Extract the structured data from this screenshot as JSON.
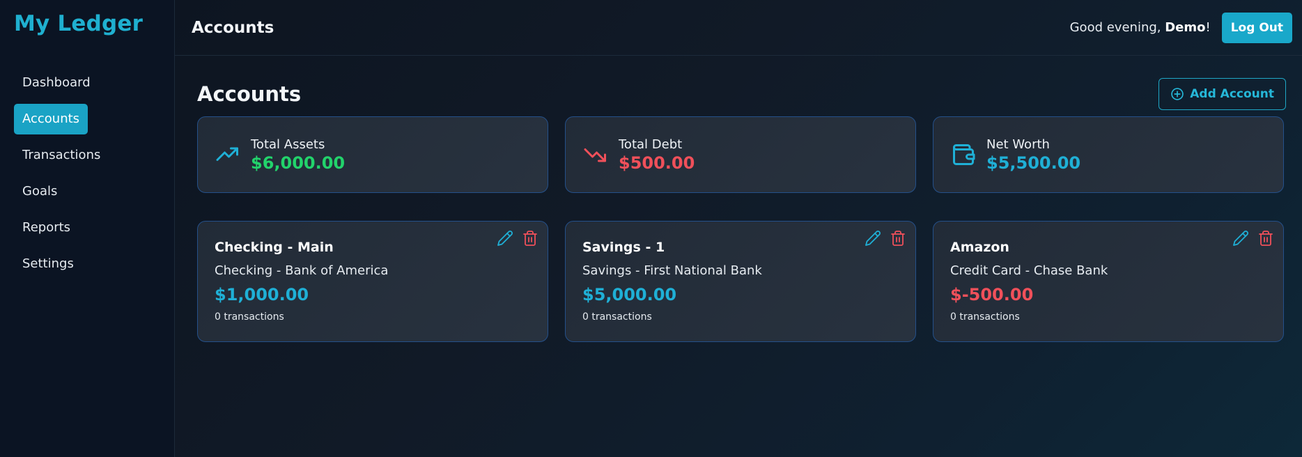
{
  "app": {
    "logo": "My Ledger"
  },
  "sidebar": {
    "items": [
      {
        "label": "Dashboard"
      },
      {
        "label": "Accounts",
        "active": true
      },
      {
        "label": "Transactions"
      },
      {
        "label": "Goals"
      },
      {
        "label": "Reports"
      },
      {
        "label": "Settings"
      }
    ]
  },
  "header": {
    "title": "Accounts",
    "greeting_prefix": "Good evening, ",
    "user_name": "Demo",
    "greeting_suffix": "!",
    "logout_label": "Log Out"
  },
  "page": {
    "title": "Accounts",
    "add_account_label": "Add Account"
  },
  "summary": [
    {
      "label": "Total Assets",
      "value": "$6,000.00",
      "icon": "trending-up-icon",
      "color": "#22d36b"
    },
    {
      "label": "Total Debt",
      "value": "$500.00",
      "icon": "trending-down-icon",
      "color": "#f0505a"
    },
    {
      "label": "Net Worth",
      "value": "$5,500.00",
      "icon": "wallet-icon",
      "color": "#1fb0d6"
    }
  ],
  "accounts": [
    {
      "name": "Checking - Main",
      "subtitle": "Checking - Bank of America",
      "balance": "$1,000.00",
      "transactions": "0 transactions",
      "color": "#1fb0d6"
    },
    {
      "name": "Savings - 1",
      "subtitle": "Savings - First National Bank",
      "balance": "$5,000.00",
      "transactions": "0 transactions",
      "color": "#1fb0d6"
    },
    {
      "name": "Amazon",
      "subtitle": "Credit Card - Chase Bank",
      "balance": "$-500.00",
      "transactions": "0 transactions",
      "color": "#f0505a"
    }
  ],
  "colors": {
    "accent": "#1aa3c5",
    "edit": "#1fb0d6",
    "delete": "#f0505a",
    "card_border": "#24508a"
  }
}
